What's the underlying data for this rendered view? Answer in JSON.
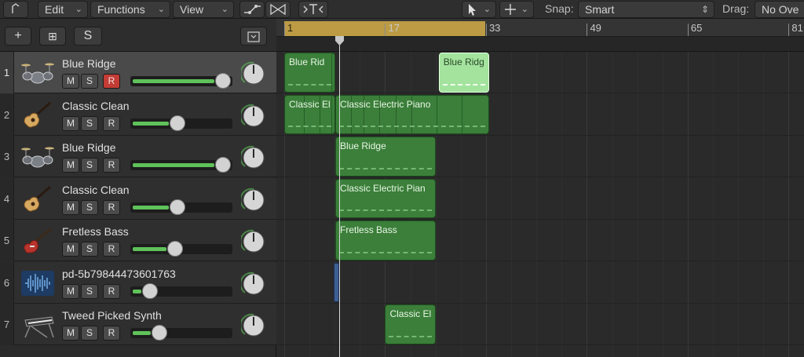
{
  "toolbar": {
    "back_icon": "↑",
    "edit": "Edit",
    "functions": "Functions",
    "view": "View",
    "snap_label": "Snap:",
    "snap_value": "Smart",
    "drag_label": "Drag:",
    "drag_value": "No Ove"
  },
  "header_buttons": {
    "add": "+",
    "duplicate": "⊞",
    "solo": "S"
  },
  "ruler": {
    "bars": [
      "1",
      "17",
      "33",
      "49",
      "65",
      "81"
    ]
  },
  "tracks": [
    {
      "num": "1",
      "name": "Blue Ridge",
      "instrument": "drums-icon",
      "m": "M",
      "s": "S",
      "r": "R",
      "rec_armed": true,
      "volume": 0.95,
      "selected": true
    },
    {
      "num": "2",
      "name": "Classic Clean",
      "instrument": "guitar-icon",
      "m": "M",
      "s": "S",
      "r": "R",
      "rec_armed": false,
      "volume": 0.48
    },
    {
      "num": "3",
      "name": "Blue Ridge",
      "instrument": "drums-icon",
      "m": "M",
      "s": "S",
      "r": "R",
      "rec_armed": false,
      "volume": 0.95
    },
    {
      "num": "4",
      "name": "Classic Clean",
      "instrument": "guitar-icon",
      "m": "M",
      "s": "S",
      "r": "R",
      "rec_armed": false,
      "volume": 0.48
    },
    {
      "num": "5",
      "name": "Fretless Bass",
      "instrument": "bass-icon",
      "m": "M",
      "s": "S",
      "r": "R",
      "rec_armed": false,
      "volume": 0.46
    },
    {
      "num": "6",
      "name": "pd-5b79844473601763",
      "instrument": "audio-waveform-icon",
      "m": "M",
      "s": "S",
      "r": "R",
      "rec_armed": false,
      "volume": 0.2
    },
    {
      "num": "7",
      "name": "Tweed Picked Synth",
      "instrument": "keyboard-icon",
      "m": "M",
      "s": "S",
      "r": "R",
      "rec_armed": false,
      "volume": 0.3
    }
  ],
  "regions": [
    {
      "name": "Blue Rid"
    },
    {
      "name": "Blue Ridg"
    },
    {
      "name": "Classic El"
    },
    {
      "name": "Classic Electric Piano"
    },
    {
      "name": "Blue Ridge"
    },
    {
      "name": "Classic Electric Pian"
    },
    {
      "name": "Fretless Bass"
    },
    {
      "name": "Classic El"
    }
  ],
  "colors": {
    "region": "#3b7f3a",
    "region_selected": "#a3e39e",
    "cycle": "#bc9b44",
    "record": "#c33c35",
    "meter": "#5fc25a"
  }
}
